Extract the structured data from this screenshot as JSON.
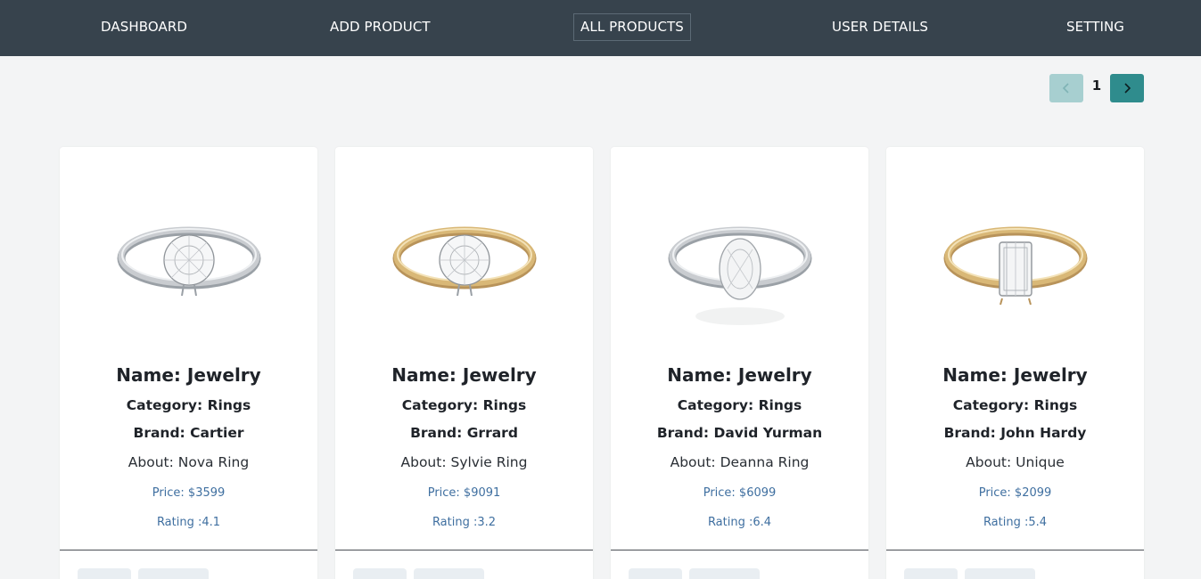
{
  "nav": {
    "items": [
      {
        "label": "DASHBOARD"
      },
      {
        "label": "ADD PRODUCT"
      },
      {
        "label": "ALL PRODUCTS"
      },
      {
        "label": "USER DETAILS"
      },
      {
        "label": "SETTING"
      }
    ],
    "active": "ALL PRODUCTS"
  },
  "pagination": {
    "current_page": "1",
    "prev_icon": "chevron-left-icon",
    "next_icon": "chevron-right-icon"
  },
  "products": [
    {
      "name": "Name: Jewelry",
      "category": "Category: Rings",
      "brand": "Brand: Cartier",
      "about": "About: Nova Ring",
      "price": "Price: $3599",
      "rating": "Rating :4.1",
      "metal": "white"
    },
    {
      "name": "Name: Jewelry",
      "category": "Category: Rings",
      "brand": "Brand: Grrard",
      "about": "About: Sylvie Ring",
      "price": "Price: $9091",
      "rating": "Rating :3.2",
      "metal": "gold"
    },
    {
      "name": "Name: Jewelry",
      "category": "Category: Rings",
      "brand": "Brand: David Yurman",
      "about": "About: Deanna Ring",
      "price": "Price: $6099",
      "rating": "Rating :6.4",
      "metal": "white"
    },
    {
      "name": "Name: Jewelry",
      "category": "Category: Rings",
      "brand": "Brand: John Hardy",
      "about": "About: Unique",
      "price": "Price: $2099",
      "rating": "Rating :5.4",
      "metal": "gold"
    }
  ],
  "colors": {
    "navbar": "#37434d",
    "pager_prev": "#a7cfd0",
    "pager_next": "#2f8c8d",
    "price_text": "#3f6fa0"
  }
}
